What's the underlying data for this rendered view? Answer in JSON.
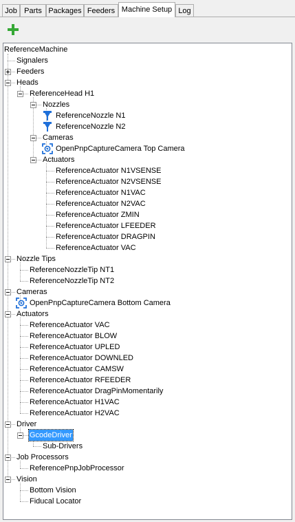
{
  "tabs": [
    "Job",
    "Parts",
    "Packages",
    "Feeders",
    "Machine Setup",
    "Log"
  ],
  "active_tab": "Machine Setup",
  "toolbar": {
    "add_icon": "plus-icon",
    "accent": "#35a835"
  },
  "tree": [
    {
      "label": "ReferenceMachine",
      "depth": 0,
      "toggle": "none"
    },
    {
      "label": "Signalers",
      "depth": 1,
      "toggle": "none"
    },
    {
      "label": "Feeders",
      "depth": 1,
      "toggle": "plus"
    },
    {
      "label": "Heads",
      "depth": 1,
      "toggle": "minus"
    },
    {
      "label": "ReferenceHead H1",
      "depth": 2,
      "toggle": "minus"
    },
    {
      "label": "Nozzles",
      "depth": 3,
      "toggle": "minus"
    },
    {
      "label": "ReferenceNozzle N1",
      "depth": 4,
      "toggle": "none",
      "icon": "nozzle"
    },
    {
      "label": "ReferenceNozzle N2",
      "depth": 4,
      "toggle": "none",
      "icon": "nozzle"
    },
    {
      "label": "Cameras",
      "depth": 3,
      "toggle": "minus"
    },
    {
      "label": "OpenPnpCaptureCamera Top Camera",
      "depth": 4,
      "toggle": "none",
      "icon": "camera"
    },
    {
      "label": "Actuators",
      "depth": 3,
      "toggle": "minus"
    },
    {
      "label": "ReferenceActuator N1VSENSE",
      "depth": 4,
      "toggle": "none"
    },
    {
      "label": "ReferenceActuator N2VSENSE",
      "depth": 4,
      "toggle": "none"
    },
    {
      "label": "ReferenceActuator N1VAC",
      "depth": 4,
      "toggle": "none"
    },
    {
      "label": "ReferenceActuator N2VAC",
      "depth": 4,
      "toggle": "none"
    },
    {
      "label": "ReferenceActuator ZMIN",
      "depth": 4,
      "toggle": "none"
    },
    {
      "label": "ReferenceActuator LFEEDER",
      "depth": 4,
      "toggle": "none"
    },
    {
      "label": "ReferenceActuator DRAGPIN",
      "depth": 4,
      "toggle": "none"
    },
    {
      "label": "ReferenceActuator VAC",
      "depth": 4,
      "toggle": "none"
    },
    {
      "label": "Nozzle Tips",
      "depth": 1,
      "toggle": "minus"
    },
    {
      "label": "ReferenceNozzleTip NT1",
      "depth": 2,
      "toggle": "none"
    },
    {
      "label": "ReferenceNozzleTip NT2",
      "depth": 2,
      "toggle": "none"
    },
    {
      "label": "Cameras",
      "depth": 1,
      "toggle": "minus"
    },
    {
      "label": "OpenPnpCaptureCamera Bottom Camera",
      "depth": 2,
      "toggle": "none",
      "icon": "camera"
    },
    {
      "label": "Actuators",
      "depth": 1,
      "toggle": "minus"
    },
    {
      "label": "ReferenceActuator VAC",
      "depth": 2,
      "toggle": "none"
    },
    {
      "label": "ReferenceActuator BLOW",
      "depth": 2,
      "toggle": "none"
    },
    {
      "label": "ReferenceActuator UPLED",
      "depth": 2,
      "toggle": "none"
    },
    {
      "label": "ReferenceActuator DOWNLED",
      "depth": 2,
      "toggle": "none"
    },
    {
      "label": "ReferenceActuator CAMSW",
      "depth": 2,
      "toggle": "none"
    },
    {
      "label": "ReferenceActuator RFEEDER",
      "depth": 2,
      "toggle": "none"
    },
    {
      "label": "ReferenceActuator DragPinMomentarily",
      "depth": 2,
      "toggle": "none"
    },
    {
      "label": "ReferenceActuator H1VAC",
      "depth": 2,
      "toggle": "none"
    },
    {
      "label": "ReferenceActuator H2VAC",
      "depth": 2,
      "toggle": "none"
    },
    {
      "label": "Driver",
      "depth": 1,
      "toggle": "minus"
    },
    {
      "label": "GcodeDriver",
      "depth": 2,
      "toggle": "minus",
      "selected": true
    },
    {
      "label": "Sub-Drivers",
      "depth": 3,
      "toggle": "none"
    },
    {
      "label": "Job Processors",
      "depth": 1,
      "toggle": "minus"
    },
    {
      "label": "ReferencePnpJobProcessor",
      "depth": 2,
      "toggle": "none"
    },
    {
      "label": "Vision",
      "depth": 1,
      "toggle": "minus"
    },
    {
      "label": "Bottom Vision",
      "depth": 2,
      "toggle": "none"
    },
    {
      "label": "Fiducal Locator",
      "depth": 2,
      "toggle": "none"
    }
  ],
  "colors": {
    "selection": "#3399ff",
    "icon_blue": "#1e6fd9",
    "tree_line": "#a0a0a0"
  }
}
